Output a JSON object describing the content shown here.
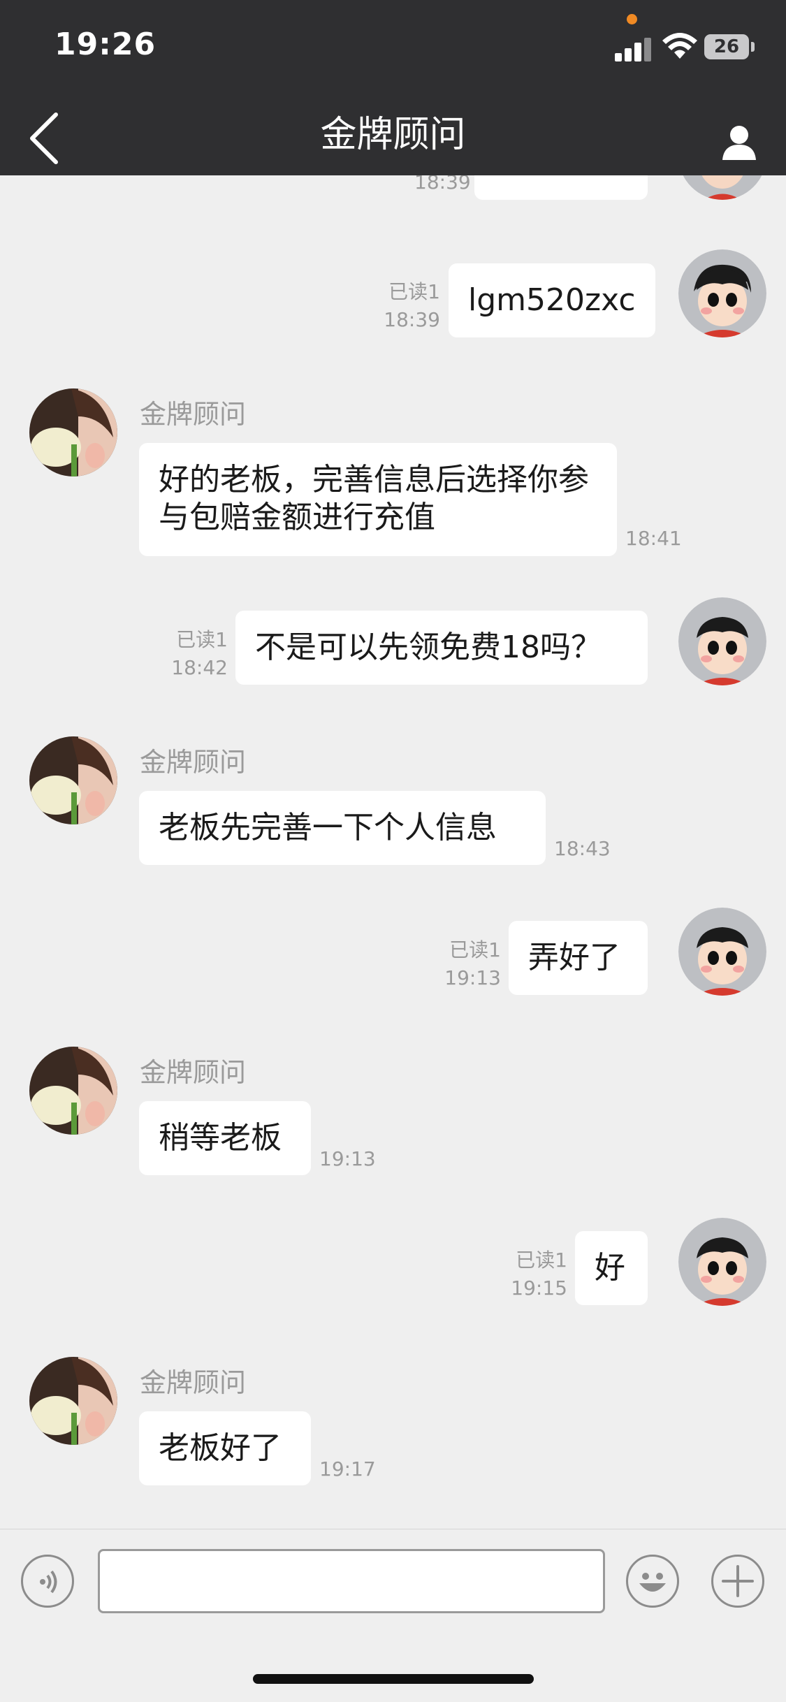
{
  "status_bar": {
    "time": "19:26",
    "battery": "26"
  },
  "nav": {
    "title": "金牌顾问"
  },
  "messages": [
    {
      "side": "right",
      "read": "已读1",
      "time": "18:39",
      "text": "lgm520zxc"
    },
    {
      "side": "left",
      "sender": "金牌顾问",
      "time": "18:41",
      "text": "好的老板，完善信息后选择你参与包赔金额进行充值"
    },
    {
      "side": "right",
      "read": "已读1",
      "time": "18:42",
      "text": "不是可以先领免费18吗？"
    },
    {
      "side": "left",
      "sender": "金牌顾问",
      "time": "18:43",
      "text": "老板先完善一下个人信息"
    },
    {
      "side": "right",
      "read": "已读1",
      "time": "19:13",
      "text": "弄好了"
    },
    {
      "side": "left",
      "sender": "金牌顾问",
      "time": "19:13",
      "text": "稍等老板"
    },
    {
      "side": "right",
      "read": "已读1",
      "time": "19:15",
      "text": "好"
    },
    {
      "side": "left",
      "sender": "金牌顾问",
      "time": "19:17",
      "text": "老板好了"
    }
  ],
  "partial_top": {
    "time": "18:39"
  },
  "input": {
    "placeholder": ""
  },
  "icons": [
    "back-icon",
    "contact-icon",
    "voice-icon",
    "emoji-icon",
    "plus-icon"
  ]
}
